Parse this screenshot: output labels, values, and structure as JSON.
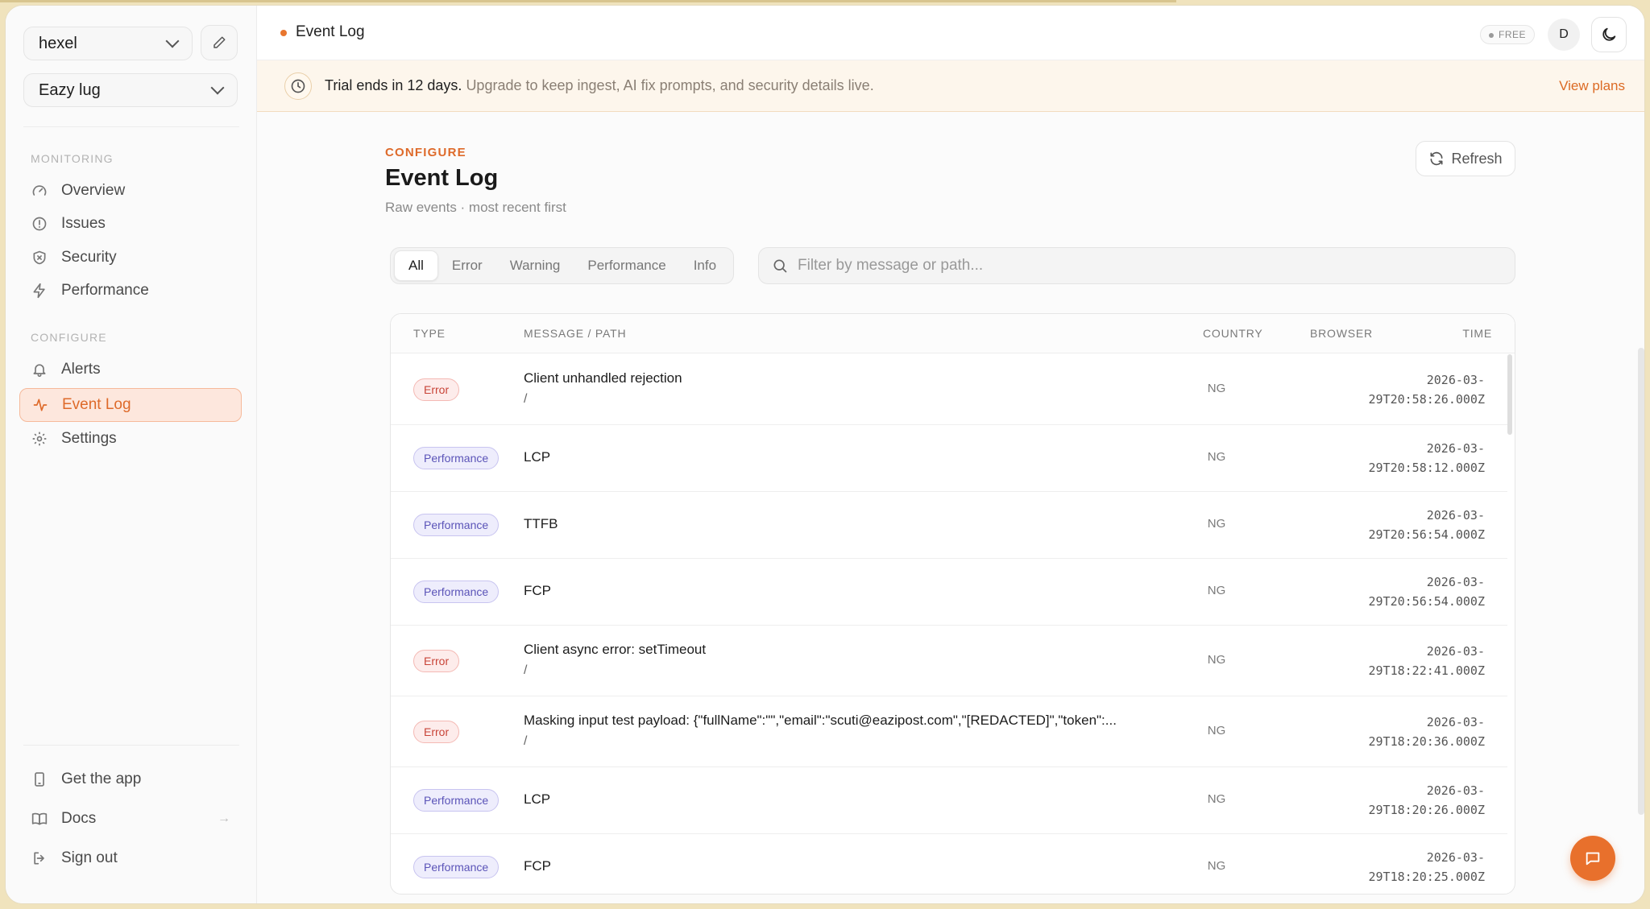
{
  "sidebar": {
    "org_select": "hexel",
    "project_select": "Eazy lug",
    "sections": [
      {
        "label": "MONITORING",
        "items": [
          {
            "label": "Overview",
            "icon": "gauge-icon"
          },
          {
            "label": "Issues",
            "icon": "alert-circle-icon"
          },
          {
            "label": "Security",
            "icon": "shield-icon"
          },
          {
            "label": "Performance",
            "icon": "bolt-icon"
          }
        ]
      },
      {
        "label": "CONFIGURE",
        "items": [
          {
            "label": "Alerts",
            "icon": "bell-icon"
          },
          {
            "label": "Event Log",
            "icon": "activity-icon",
            "active": true
          },
          {
            "label": "Settings",
            "icon": "gear-icon"
          }
        ]
      }
    ],
    "footer": [
      {
        "label": "Get the app",
        "icon": "phone-icon"
      },
      {
        "label": "Docs",
        "icon": "book-icon"
      },
      {
        "label": "Sign out",
        "icon": "sign-out-icon"
      }
    ]
  },
  "topbar": {
    "breadcrumb": "Event Log",
    "plan_badge": "FREE",
    "avatar_initial": "D"
  },
  "trial": {
    "bold": "Trial ends in 12 days.",
    "text": "Upgrade to keep ingest, AI fix prompts, and security details live.",
    "link": "View plans"
  },
  "header": {
    "eyebrow": "CONFIGURE",
    "title": "Event Log",
    "subtitle": "Raw events · most recent first",
    "refresh": "Refresh"
  },
  "filters": {
    "tabs": [
      "All",
      "Error",
      "Warning",
      "Performance",
      "Info"
    ],
    "active_tab": "All",
    "search_placeholder": "Filter by message or path..."
  },
  "table": {
    "columns": [
      "TYPE",
      "MESSAGE / PATH",
      "COUNTRY",
      "BROWSER",
      "TIME"
    ],
    "rows": [
      {
        "type": "Error",
        "message": "Client unhandled rejection",
        "path": "/",
        "country": "NG",
        "browser": "",
        "time_date": "2026-03-",
        "time_rest": "29T20:58:26.000Z"
      },
      {
        "type": "Performance",
        "message": "LCP",
        "path": "",
        "country": "NG",
        "browser": "",
        "time_date": "2026-03-",
        "time_rest": "29T20:58:12.000Z"
      },
      {
        "type": "Performance",
        "message": "TTFB",
        "path": "",
        "country": "NG",
        "browser": "",
        "time_date": "2026-03-",
        "time_rest": "29T20:56:54.000Z"
      },
      {
        "type": "Performance",
        "message": "FCP",
        "path": "",
        "country": "NG",
        "browser": "",
        "time_date": "2026-03-",
        "time_rest": "29T20:56:54.000Z"
      },
      {
        "type": "Error",
        "message": "Client async error: setTimeout",
        "path": "/",
        "country": "NG",
        "browser": "",
        "time_date": "2026-03-",
        "time_rest": "29T18:22:41.000Z"
      },
      {
        "type": "Error",
        "message": "Masking input test payload: {\"fullName\":\"\",\"email\":\"scuti@eazipost.com\",\"[REDACTED]\",\"token\":...",
        "path": "/",
        "country": "NG",
        "browser": "",
        "time_date": "2026-03-",
        "time_rest": "29T18:20:36.000Z"
      },
      {
        "type": "Performance",
        "message": "LCP",
        "path": "",
        "country": "NG",
        "browser": "",
        "time_date": "2026-03-",
        "time_rest": "29T18:20:26.000Z"
      },
      {
        "type": "Performance",
        "message": "FCP",
        "path": "",
        "country": "NG",
        "browser": "",
        "time_date": "2026-03-",
        "time_rest": "29T18:20:25.000Z"
      }
    ]
  },
  "colors": {
    "accent": "#e8702c",
    "error_badge": "#c84438",
    "performance_badge": "#5b54b8"
  }
}
